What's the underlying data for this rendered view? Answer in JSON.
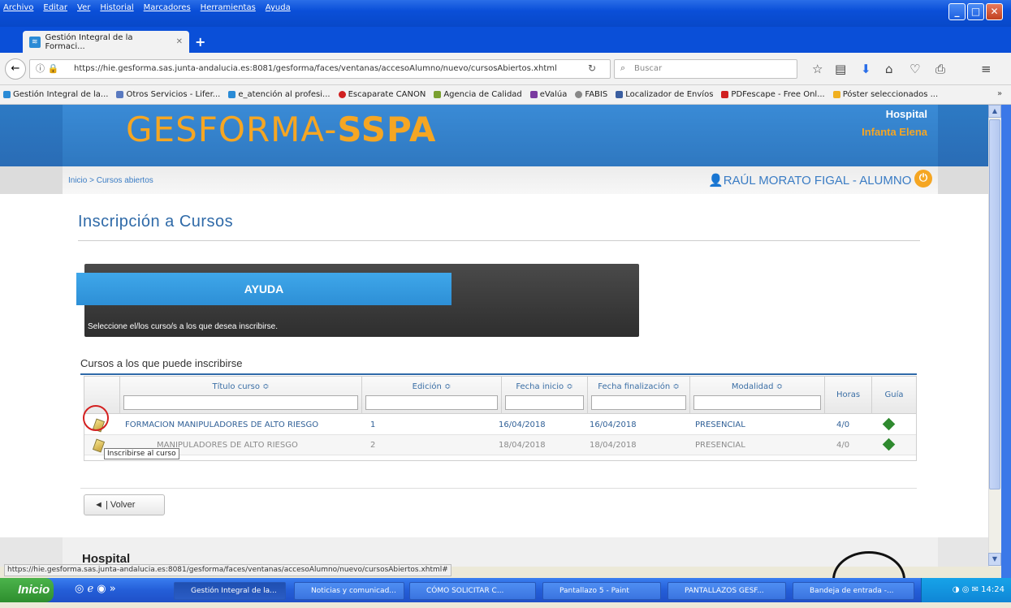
{
  "menu": [
    "Archivo",
    "Editar",
    "Ver",
    "Historial",
    "Marcadores",
    "Herramientas",
    "Ayuda"
  ],
  "tab": {
    "title": "Gestión Integral de la Formaci..."
  },
  "nav": {
    "url": "https://hie.gesforma.sas.junta-andalucia.es:8081/gesforma/faces/ventanas/accesoAlumno/nuevo/cursosAbiertos.xhtml",
    "search_placeholder": "Buscar"
  },
  "bookmarks": [
    "Gestión Integral de la...",
    "Otros Servicios - Lifer...",
    "e_atención al profesi...",
    "Escaparate CANON",
    "Agencia de Calidad",
    "eValúa",
    "FABIS",
    "Localizador de Envíos",
    "PDFescape - Free Onl...",
    "Póster seleccionados ..."
  ],
  "header": {
    "logo_light": "GESFORMA-",
    "logo_bold": "SSPA",
    "hospital": "Hospital",
    "hospital_name": "Infanta Elena"
  },
  "breadcrumb": "Inicio > Cursos abiertos",
  "user": "RAÚL MORATO FIGAL - ALUMNO",
  "page_title": "Inscripción a Cursos",
  "help": {
    "title": "AYUDA",
    "text": "Seleccione el/los curso/s a los que desea inscribirse."
  },
  "table": {
    "caption": "Cursos a los que puede inscribirse",
    "headers": {
      "titulo": "Título curso ≎",
      "edicion": "Edición ≎",
      "inicio": "Fecha inicio ≎",
      "fin": "Fecha finalización ≎",
      "modalidad": "Modalidad ≎",
      "horas": "Horas",
      "guia": "Guía"
    },
    "rows": [
      {
        "titulo": "FORMACION MANIPULADORES DE ALTO RIESGO",
        "edicion": "1",
        "inicio": "16/04/2018",
        "fin": "16/04/2018",
        "modalidad": "PRESENCIAL",
        "horas": "4/0"
      },
      {
        "titulo": "MANIPULADORES DE ALTO RIESGO",
        "edicion": "2",
        "inicio": "18/04/2018",
        "fin": "18/04/2018",
        "modalidad": "PRESENCIAL",
        "horas": "4/0"
      }
    ]
  },
  "tooltip": "Inscribirse al curso",
  "back_button": "Volver",
  "footer_hospital": "Hospital",
  "status_url": "https://hie.gesforma.sas.junta-andalucia.es:8081/gesforma/faces/ventanas/accesoAlumno/nuevo/cursosAbiertos.xhtml#",
  "taskbar": {
    "start": "Inicio",
    "items": [
      "Gestión Integral de la...",
      "Noticias y comunicad...",
      "CÓMO SOLICITAR C...",
      "Pantallazo 5 - Paint",
      "PANTALLAZOS GESF...",
      "Bandeja de entrada -..."
    ],
    "clock": "14:24"
  }
}
